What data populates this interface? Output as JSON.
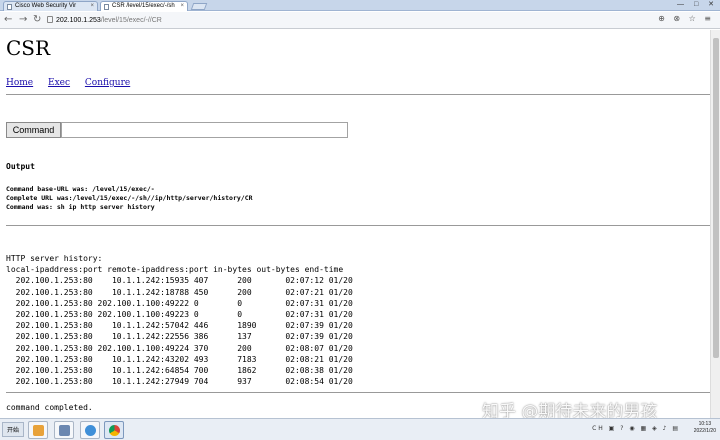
{
  "browser": {
    "tabs": [
      {
        "title": "Cisco Web Security Vir"
      },
      {
        "title": "CSR /level/15/exec/-/sh"
      }
    ],
    "address": {
      "host": "202.100.1.253",
      "path": "/level/15/exec/-//CR"
    },
    "window_controls": "— □ ✕",
    "toolbar_icons": "⊕ ⊗ ☆ ≡"
  },
  "page": {
    "title": "CSR",
    "nav": [
      "Home",
      "Exec",
      "Configure"
    ],
    "command_button": "Command",
    "command_value": "",
    "output_heading": "Output",
    "info_lines": [
      "Command base-URL was: /level/15/exec/-",
      "Complete URL was:/level/15/exec/-/sh//ip/http/server/history/CR",
      "Command was: sh  ip http server history"
    ],
    "history_title": "HTTP server history:",
    "history_columns": [
      "local-ipaddress:port",
      "remote-ipaddress:port",
      "in-bytes",
      "out-bytes",
      "end-time"
    ],
    "history_rows": [
      [
        "202.100.1.253:80",
        "10.1.1.242:15935",
        "407",
        "200",
        "02:07:12 01/20"
      ],
      [
        "202.100.1.253:80",
        "10.1.1.242:18788",
        "450",
        "200",
        "02:07:21 01/20"
      ],
      [
        "202.100.1.253:80",
        "202.100.1.100:49222",
        "0",
        "0",
        "02:07:31 01/20"
      ],
      [
        "202.100.1.253:80",
        "202.100.1.100:49223",
        "0",
        "0",
        "02:07:31 01/20"
      ],
      [
        "202.100.1.253:80",
        "10.1.1.242:57042",
        "446",
        "1890",
        "02:07:39 01/20"
      ],
      [
        "202.100.1.253:80",
        "10.1.1.242:22556",
        "386",
        "137",
        "02:07:39 01/20"
      ],
      [
        "202.100.1.253:80",
        "202.100.1.100:49224",
        "370",
        "200",
        "02:08:07 01/20"
      ],
      [
        "202.100.1.253:80",
        "10.1.1.242:43202",
        "493",
        "7183",
        "02:08:21 01/20"
      ],
      [
        "202.100.1.253:80",
        "10.1.1.242:64854",
        "700",
        "1862",
        "02:08:38 01/20"
      ],
      [
        "202.100.1.253:80",
        "10.1.1.242:27949",
        "704",
        "937",
        "02:08:54 01/20"
      ]
    ],
    "completion": "command completed."
  },
  "watermark": "知乎 @期待未来的男孩",
  "taskbar": {
    "start": "开始",
    "tray_icons": "CH ▣ ? ◉ ▦ ◈ ♪ ▤",
    "time": "10:13",
    "date": "2022/1/20"
  },
  "colors": {
    "link": "#1a0dab",
    "chrome": "#c7d6ea"
  }
}
